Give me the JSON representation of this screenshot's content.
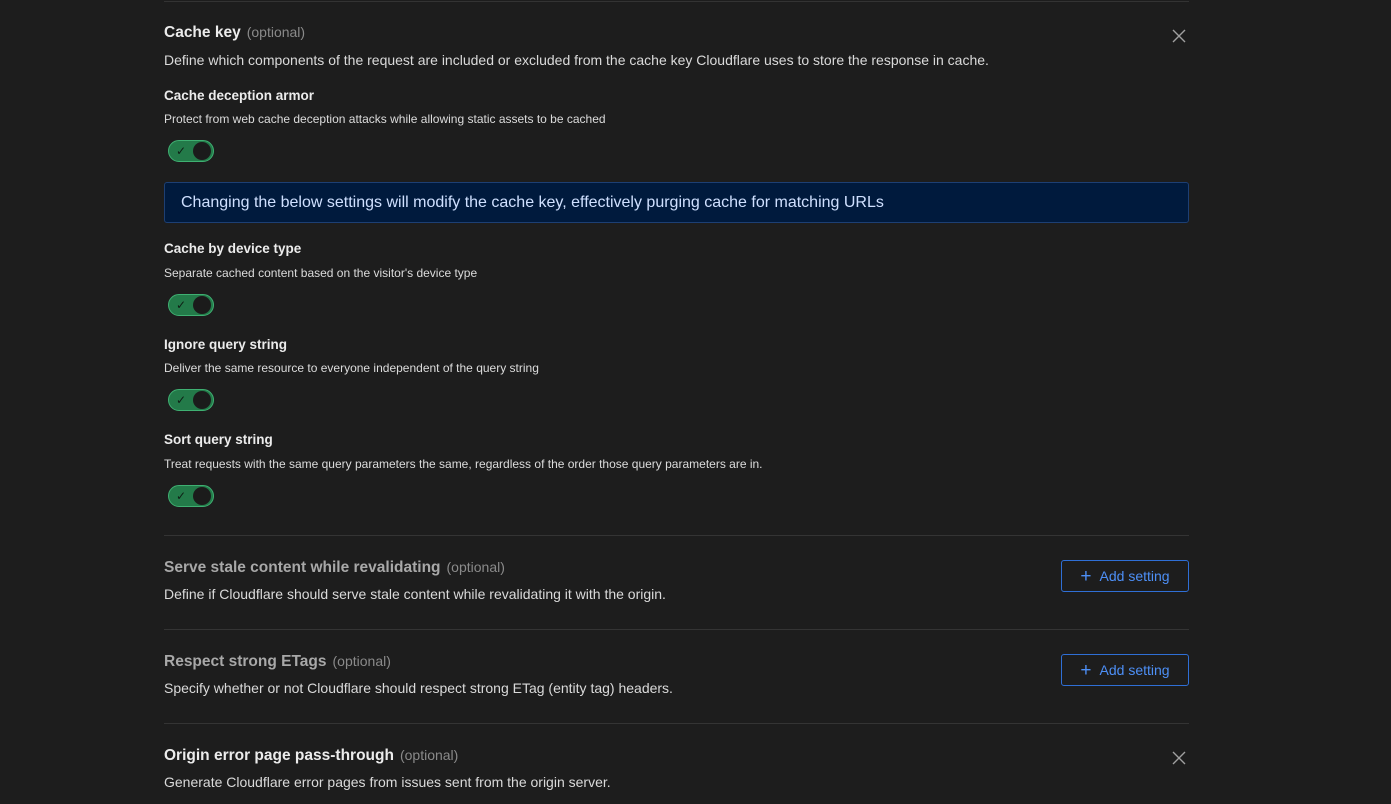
{
  "cache_key": {
    "title": "Cache key",
    "optional": "(optional)",
    "description": "Define which components of the request are included or excluded from the cache key Cloudflare uses to store the response in cache.",
    "settings": [
      {
        "title": "Cache deception armor",
        "description": "Protect from web cache deception attacks while allowing static assets to be cached",
        "enabled": true
      },
      {
        "title": "Cache by device type",
        "description": "Separate cached content based on the visitor's device type",
        "enabled": true
      },
      {
        "title": "Ignore query string",
        "description": "Deliver the same resource to everyone independent of the query string",
        "enabled": true
      },
      {
        "title": "Sort query string",
        "description": "Treat requests with the same query parameters the same, regardless of the order those query parameters are in.",
        "enabled": true
      }
    ],
    "banner": "Changing the below settings will modify the cache key, effectively purging cache for matching URLs"
  },
  "serve_stale": {
    "title": "Serve stale content while revalidating",
    "optional": "(optional)",
    "description": "Define if Cloudflare should serve stale content while revalidating it with the origin.",
    "button_label": "Add setting"
  },
  "strong_etags": {
    "title": "Respect strong ETags",
    "optional": "(optional)",
    "description": "Specify whether or not Cloudflare should respect strong ETag (entity tag) headers.",
    "button_label": "Add setting"
  },
  "origin_error": {
    "title": "Origin error page pass-through",
    "optional": "(optional)",
    "description": "Generate Cloudflare error pages from issues sent from the origin server."
  },
  "icons": {
    "close": "close-icon",
    "plus": "plus-icon",
    "check": "check-icon"
  },
  "colors": {
    "background": "#1d1d1d",
    "toggle_on": "#237a49",
    "banner_bg": "#001a3d",
    "link_blue": "#4d8ff6"
  }
}
